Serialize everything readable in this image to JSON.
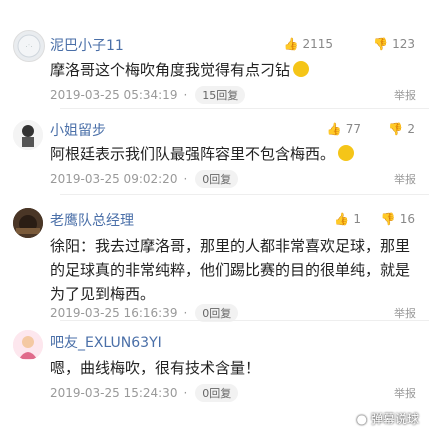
{
  "comments": [
    {
      "username": "泥巴小子11",
      "up": "2115",
      "down": "123",
      "text": "摩洛哥这个梅吹角度我觉得有点刁钻",
      "time": "2019-03-25 05:34:19",
      "dot": "·",
      "replies": "15回复",
      "report": "举报"
    },
    {
      "username": "小姐留步",
      "up": "77",
      "down": "2",
      "text": "阿根廷表示我们队最强阵容里不包含梅西。",
      "time": "2019-03-25 09:02:20",
      "dot": "·",
      "replies": "0回复",
      "report": "举报"
    },
    {
      "username": "老鹰队总经理",
      "up": "1",
      "down": "16",
      "text": "徐阳：我去过摩洛哥，那里的人都非常喜欢足球，那里的足球真的非常纯粹，他们踢比赛的目的很单纯，就是为了见到梅西。",
      "time": "2019-03-25 16:16:39",
      "dot": "·",
      "replies": "0回复",
      "report": "举报"
    },
    {
      "username": "吧友_EXLUN63YI",
      "up": "",
      "down": "",
      "text": "嗯，曲线梅吹，很有技术含量！",
      "time": "2019-03-25 15:24:30",
      "dot": "·",
      "replies": "0回复",
      "report": "举报"
    }
  ],
  "watermark": "弹幕说球"
}
